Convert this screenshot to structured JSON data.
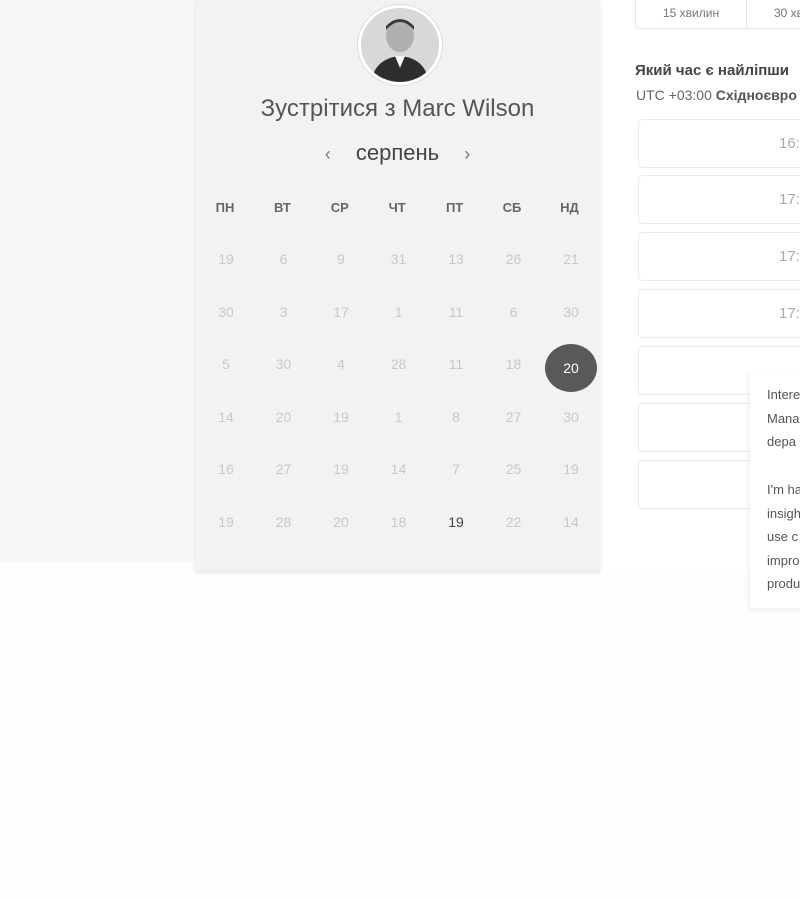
{
  "scheduler": {
    "title": "Зустрітися з Marc Wilson",
    "avatar_alt": "Marc Wilson",
    "month": "серпень",
    "prev_icon": "‹",
    "next_icon": "›",
    "weekdays": [
      "ПН",
      "ВТ",
      "СР",
      "ЧТ",
      "ПТ",
      "СБ",
      "НД"
    ],
    "weeks": [
      [
        "19",
        "6",
        "9",
        "31",
        "13",
        "26",
        "21"
      ],
      [
        "30",
        "3",
        "17",
        "1",
        "11",
        "6",
        "30"
      ],
      [
        "5",
        "30",
        "4",
        "28",
        "11",
        "18",
        "20"
      ],
      [
        "14",
        "20",
        "19",
        "1",
        "8",
        "27",
        "30"
      ],
      [
        "16",
        "27",
        "19",
        "14",
        "7",
        "25",
        "19"
      ],
      [
        "19",
        "28",
        "20",
        "18",
        "19",
        "22",
        "14"
      ]
    ],
    "selected_day": "20",
    "available_day": "19"
  },
  "duration_tabs": [
    "15 хвилин",
    "30 хв"
  ],
  "time_picker": {
    "question": "Який час є найліпши",
    "timezone_offset": "UTC +03:00",
    "timezone_name": "Східноєвро",
    "slots": [
      "16:",
      "17:",
      "17:",
      "17:",
      "",
      "",
      ""
    ]
  },
  "tooltip": {
    "lines_1": [
      "Intere",
      "Mana",
      "depa"
    ],
    "lines_2": [
      "I'm ha",
      "insigh",
      "use c",
      "impro",
      "produ"
    ]
  },
  "colors": {
    "selected_day_bg": "#595959",
    "card_bg": "#f2f2f2"
  }
}
